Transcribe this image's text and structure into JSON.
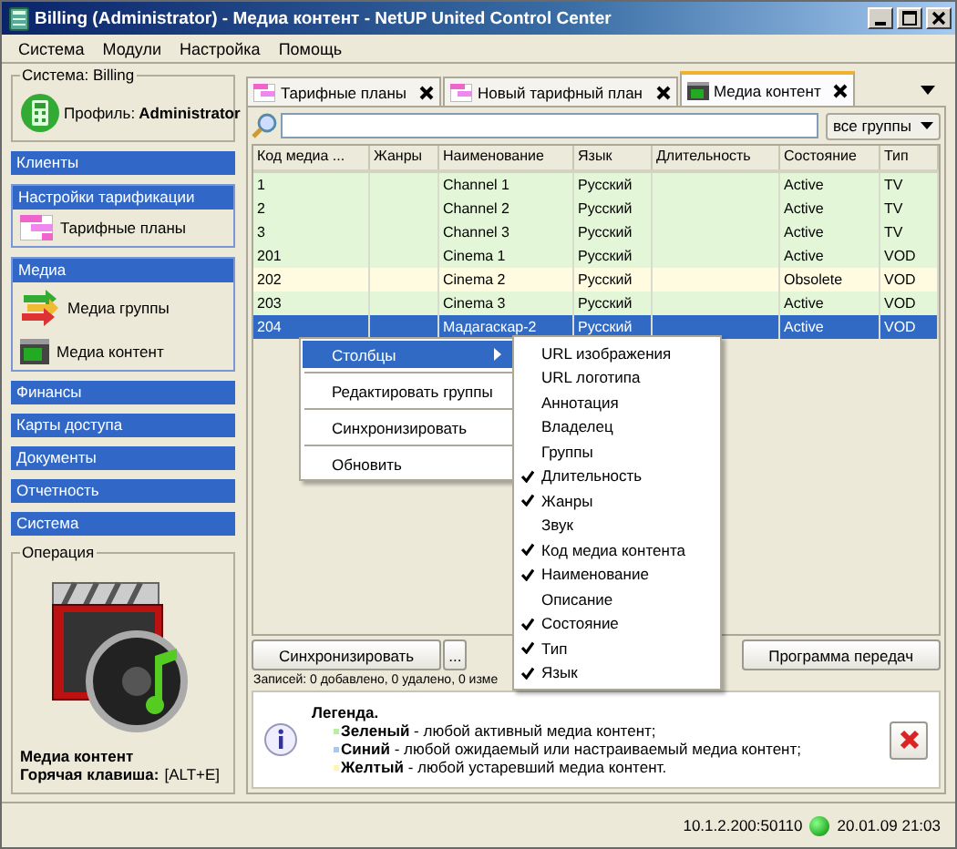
{
  "window": {
    "title": "Billing (Administrator) - Медиа контент - NetUP United Control Center"
  },
  "menu": [
    "Система",
    "Модули",
    "Настройка",
    "Помощь"
  ],
  "system_box": {
    "legend": "Система: Billing",
    "profile_label": "Профиль:",
    "profile_value": "Administrator"
  },
  "sidebar": [
    {
      "label": "Клиенты",
      "expanded": false
    },
    {
      "label": "Настройки тарификации",
      "expanded": true,
      "children": [
        {
          "label": "Тарифные планы",
          "kind": "tariff"
        }
      ]
    },
    {
      "label": "Медиа",
      "expanded": true,
      "children": [
        {
          "label": "Медиа группы",
          "kind": "groups"
        },
        {
          "label": "Медиа контент",
          "kind": "media"
        }
      ]
    },
    {
      "label": "Финансы",
      "expanded": false
    },
    {
      "label": "Карты доступа",
      "expanded": false
    },
    {
      "label": "Документы",
      "expanded": false
    },
    {
      "label": "Отчетность",
      "expanded": false
    },
    {
      "label": "Система",
      "expanded": false
    }
  ],
  "operation": {
    "legend": "Операция",
    "name": "Медиа контент",
    "hotkey_label": "Горячая клавиша:",
    "hotkey": "[ALT+E]"
  },
  "tabs": [
    {
      "label": "Тарифные планы",
      "selected": false
    },
    {
      "label": "Новый тарифный план",
      "selected": false
    },
    {
      "label": "Медиа контент",
      "selected": true
    }
  ],
  "filter": {
    "value": "все группы"
  },
  "table": {
    "columns": [
      "Код медиа ...",
      "Жанры",
      "Наименование",
      "Язык",
      "Длительность",
      "Состояние",
      "Тип"
    ],
    "rows": [
      {
        "code": "1",
        "name": "Channel 1",
        "language": "Русский",
        "status": "Active",
        "type": "TV",
        "color": "#e4f6d8",
        "selected": false
      },
      {
        "code": "2",
        "name": "Channel 2",
        "language": "Русский",
        "status": "Active",
        "type": "TV",
        "color": "#e4f6d8",
        "selected": false
      },
      {
        "code": "3",
        "name": "Channel 3",
        "language": "Русский",
        "status": "Active",
        "type": "TV",
        "color": "#e4f6d8",
        "selected": false
      },
      {
        "code": "201",
        "name": "Cinema 1",
        "language": "Русский",
        "status": "Active",
        "type": "VOD",
        "color": "#e4f6d8",
        "selected": false
      },
      {
        "code": "202",
        "name": "Cinema 2",
        "language": "Русский",
        "status": "Obsolete",
        "type": "VOD",
        "color": "#fefbe0",
        "selected": false
      },
      {
        "code": "203",
        "name": "Cinema 3",
        "language": "Русский",
        "status": "Active",
        "type": "VOD",
        "color": "#e4f6d8",
        "selected": false
      },
      {
        "code": "204",
        "name": "Мадагаскар-2",
        "language": "Русский",
        "status": "Active",
        "type": "VOD",
        "selected": true
      }
    ]
  },
  "buttons": {
    "sync": "Синхронизировать",
    "more": "...",
    "schedule": "Программа передач"
  },
  "records": "Записей: 0 добавлено, 0 удалено, 0 изме",
  "legend": {
    "title": "Легенда.",
    "items": [
      {
        "text": "**Зеленый** - любой активный медиа контент;",
        "color": "#b8eea0"
      },
      {
        "text": "**Синий** - любой ожидаемый или настраиваемый медиа контент;",
        "color": "#a8c8f0"
      },
      {
        "text": "**Желтый** - любой устаревший медиа контент.",
        "color": "#fff4b0"
      }
    ]
  },
  "context_menu": [
    {
      "label": "Столбцы",
      "kind": "submenu",
      "selected": true
    },
    {
      "label": "Редактировать группы",
      "kind": "action",
      "selected": false
    },
    {
      "label": "Синхронизировать",
      "kind": "action",
      "selected": false
    },
    {
      "label": "Обновить",
      "kind": "action",
      "selected": false
    }
  ],
  "columns_submenu": [
    {
      "label": "URL изображения",
      "checked": false
    },
    {
      "label": "URL логотипа",
      "checked": false
    },
    {
      "label": "Аннотация",
      "checked": false
    },
    {
      "label": "Владелец",
      "checked": false
    },
    {
      "label": "Группы",
      "checked": false
    },
    {
      "label": "Длительность",
      "checked": true
    },
    {
      "label": "Жанры",
      "checked": true
    },
    {
      "label": "Звук",
      "checked": false
    },
    {
      "label": "Код медиа контента",
      "checked": true
    },
    {
      "label": "Наименование",
      "checked": true
    },
    {
      "label": "Описание",
      "checked": false
    },
    {
      "label": "Состояние",
      "checked": true
    },
    {
      "label": "Тип",
      "checked": true
    },
    {
      "label": "Язык",
      "checked": true
    }
  ],
  "status_bar": {
    "address": "10.1.2.200:50110",
    "connected": true,
    "datetime": "20.01.09 21:03"
  }
}
